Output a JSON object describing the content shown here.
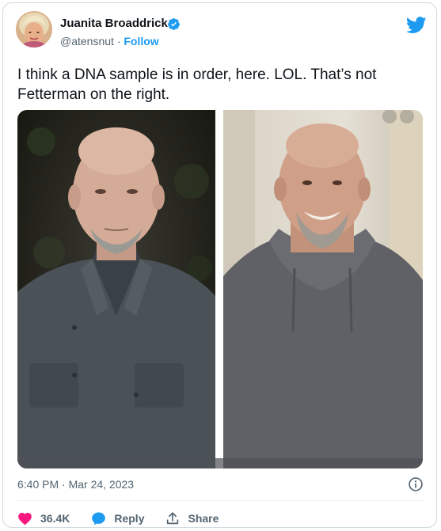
{
  "author": {
    "name": "Juanita Broaddrick",
    "handle": "@atensnut",
    "separator": "·",
    "follow_label": "Follow"
  },
  "tweet": {
    "text": "I think a DNA sample is in order, here.  LOL.  That’s not Fetterman on the right.",
    "time": "6:40 PM · Mar 24, 2023"
  },
  "actions": {
    "likes": "36.4K",
    "reply_label": "Reply",
    "share_label": "Share"
  },
  "icons": [
    "verified-badge-icon",
    "twitter-bird-icon",
    "info-icon",
    "heart-icon",
    "reply-bubble-icon",
    "share-icon"
  ],
  "colors": {
    "accent": "#1d9bf0",
    "like": "#f91880",
    "text": "#0f1419",
    "muted": "#536471"
  }
}
